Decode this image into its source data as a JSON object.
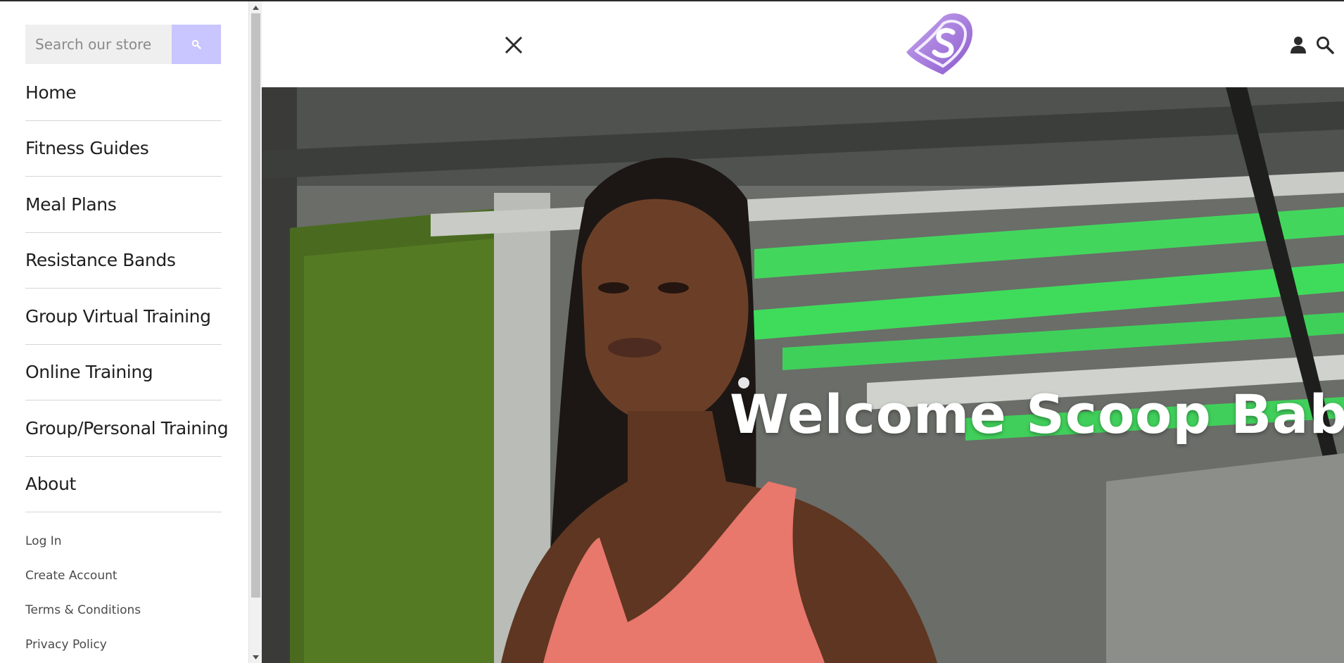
{
  "search": {
    "placeholder": "Search our store",
    "button_icon": "search-icon",
    "button_color": "#c9c5ff"
  },
  "main_nav": [
    {
      "label": "Home"
    },
    {
      "label": "Fitness Guides"
    },
    {
      "label": "Meal Plans"
    },
    {
      "label": "Resistance Bands"
    },
    {
      "label": "Group Virtual Training"
    },
    {
      "label": "Online Training"
    },
    {
      "label": "Group/Personal Training"
    },
    {
      "label": "About"
    }
  ],
  "sub_nav": [
    {
      "label": "Log In"
    },
    {
      "label": "Create Account"
    },
    {
      "label": "Terms & Conditions"
    },
    {
      "label": "Privacy Policy"
    }
  ],
  "header": {
    "close_icon": "close-icon",
    "logo_icon": "heart-s-logo",
    "logo_color": "#9b6fd6",
    "account_icon": "user-icon",
    "search_icon": "search-icon"
  },
  "hero": {
    "title": "Welcome Scoop Babes"
  },
  "colors": {
    "accent": "#c9c5ff",
    "brand": "#9b6fd6",
    "hero_green": "#3fdc5b",
    "top_tank": "#e8776c"
  }
}
